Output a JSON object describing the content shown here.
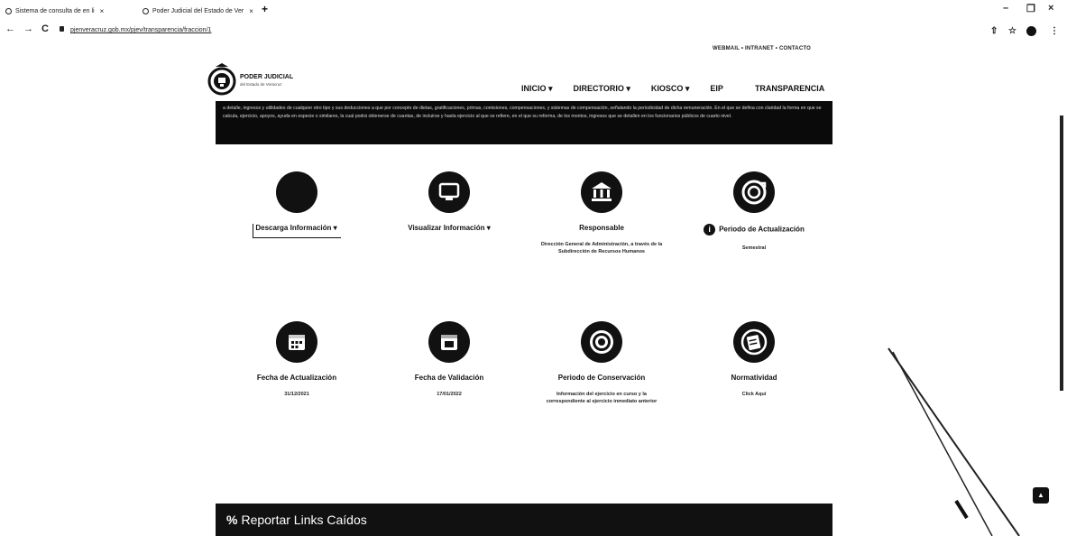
{
  "browser": {
    "tabs": [
      {
        "title": "Sistema de consulta de en li",
        "close": "×"
      },
      {
        "title": "Poder Judicial del Estado de Ver",
        "close": "×"
      }
    ],
    "new_tab": "+",
    "window_controls": {
      "minimize": "–",
      "restore": "❐",
      "close": "×"
    },
    "nav": {
      "back": "←",
      "forward": "→",
      "reload": "C"
    },
    "url": "pjenveracruz.gob.mx/pjev/transparencia/fraccion/1"
  },
  "header": {
    "top_links": "WEBMAIL  •  INTRANET  •  CONTACTO",
    "logo_title": "PODER JUDICIAL",
    "logo_subtitle": "del Estado de Veracruz",
    "nav": [
      "INICIO ▾",
      "DIRECTORIO ▾",
      "KIOSCO ▾",
      "EIP",
      "TRANSPARENCIA"
    ]
  },
  "banner": {
    "text": "a detalle, ingresos y utilidades de cualquier otro tipo y sus deducciones a que por concepto de dietas, gratificaciones, primas, comisiones, compensaciones, y sistemas de compensación, señalando la periodicidad de dicha remuneración. En el que se defina con claridad la forma en que se calcula, ejercicio, apoyos, ayuda en especie o similares, la cual podrá obtenerse de cuantas, de incluirse y hasta ejercicio al que se refiere, en el que su reforma, de los montos, ingresos que se detallen en los funcionarios públicos de cuarto nivel."
  },
  "grid": [
    {
      "label": "Descarga Información ▾",
      "value": "",
      "icon": "dark-circle-icon"
    },
    {
      "label": "Visualizar Información ▾",
      "value": "",
      "icon": "monitor-icon"
    },
    {
      "label": "Responsable",
      "value": "Dirección General de Administración, a través de la Subdirección de Recursos Humanos",
      "icon": "bank-icon"
    },
    {
      "label": "Periodo de Actualización",
      "value": "Semestral",
      "icon": "refresh-icon"
    },
    {
      "label": "Fecha de Actualización",
      "value": "31/12/2021",
      "icon": "calendar-icon"
    },
    {
      "label": "Fecha de Validación",
      "value": "17/01/2022",
      "icon": "calendar-check-icon"
    },
    {
      "label": "Periodo de Conservación",
      "value": "Información del ejercicio en curso y la correspondiente al ejercicio inmediato anterior",
      "icon": "target-icon"
    },
    {
      "label": "Normatividad",
      "value": "Click Aquí",
      "icon": "book-icon"
    }
  ],
  "info_icon": "i",
  "report": {
    "label": "Reportar Links Caídos",
    "icon": "%"
  },
  "to_top": "▲"
}
